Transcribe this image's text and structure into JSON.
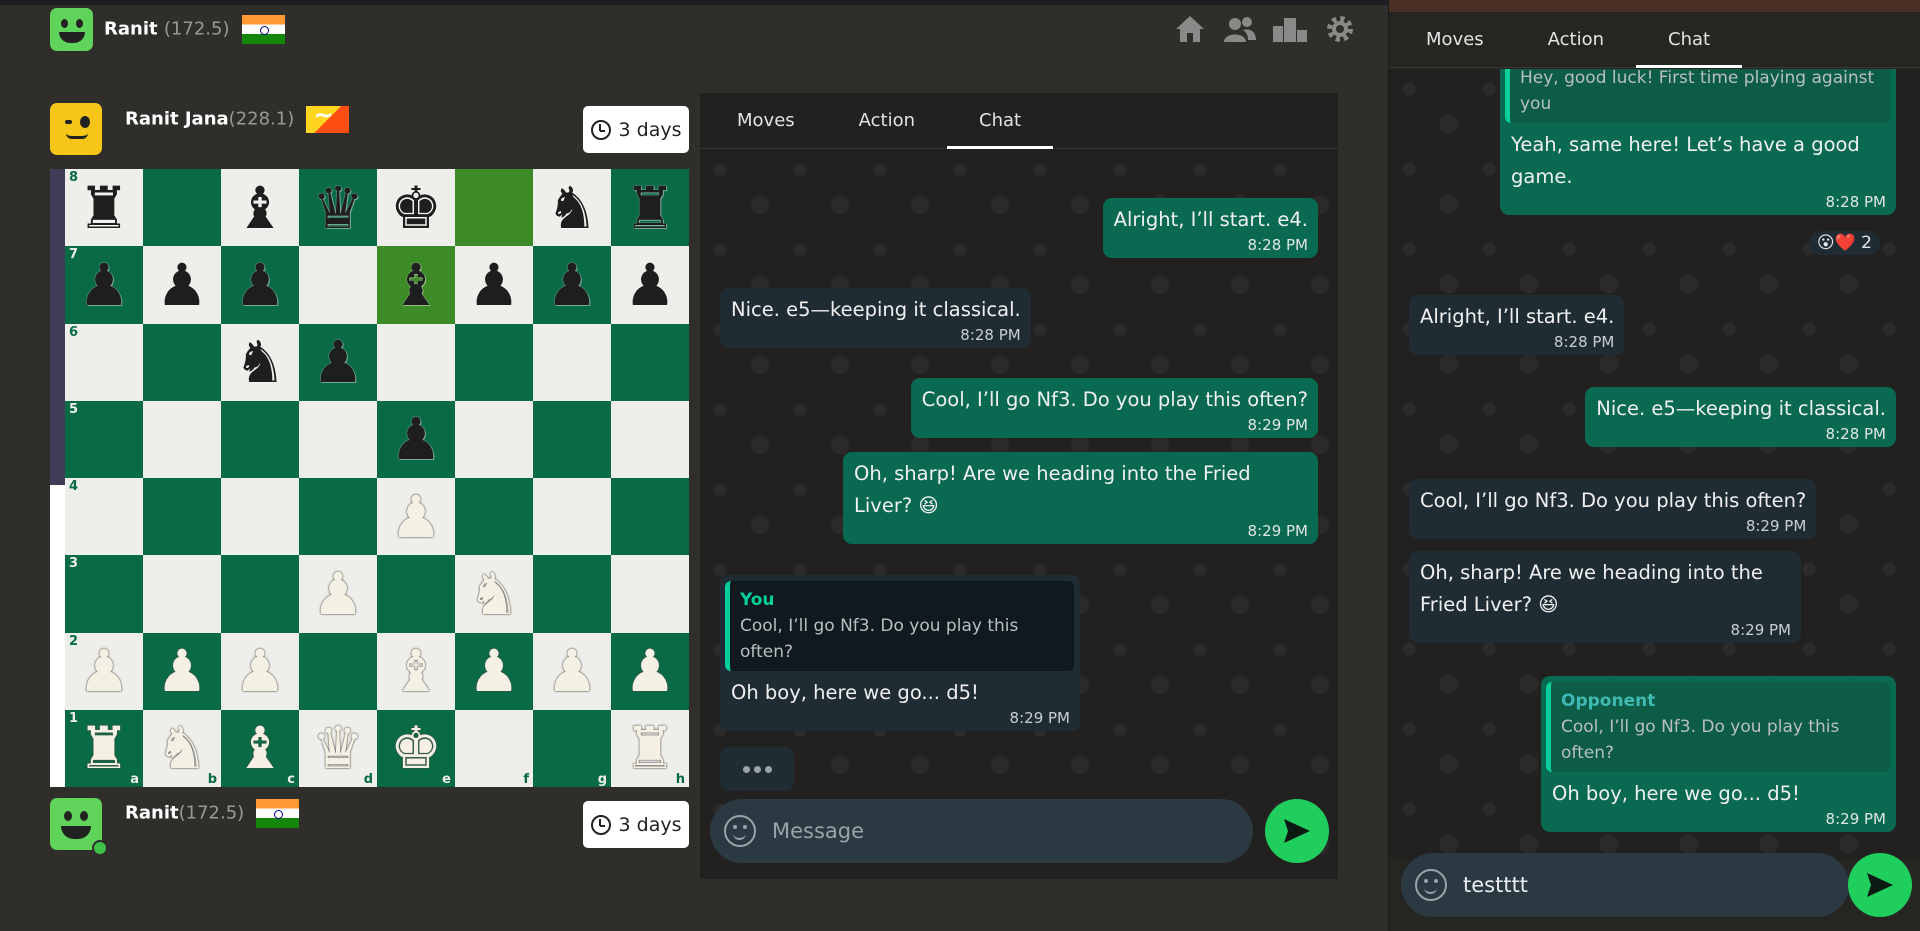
{
  "top_player": {
    "name": "Ranit",
    "rating": "(172.5)"
  },
  "opponent": {
    "name": "Ranit Jana",
    "rating": "(228.1)",
    "clock": "3 days"
  },
  "self": {
    "name": "Ranit",
    "rating": "(172.5)",
    "clock": "3 days"
  },
  "nav_icons": [
    "home-icon",
    "friends-icon",
    "leaderboard-icon",
    "settings-icon"
  ],
  "board": {
    "orientation": "white",
    "highlighted": [
      "e7",
      "f8"
    ],
    "position": [
      [
        "r",
        "",
        "b",
        "q",
        "k",
        "",
        "n",
        "r"
      ],
      [
        "p",
        "p",
        "p",
        "",
        "b",
        "p",
        "p",
        "p"
      ],
      [
        "",
        "",
        "n",
        "p",
        "",
        "",
        "",
        ""
      ],
      [
        "",
        "",
        "",
        "",
        "p",
        "",
        "",
        ""
      ],
      [
        "",
        "",
        "",
        "",
        "P",
        "",
        "",
        ""
      ],
      [
        "",
        "",
        "",
        "P",
        "",
        "N",
        "",
        ""
      ],
      [
        "P",
        "P",
        "P",
        "",
        "B",
        "P",
        "P",
        "P"
      ],
      [
        "R",
        "N",
        "B",
        "Q",
        "K",
        "",
        "",
        "R"
      ]
    ],
    "ranks": [
      "8",
      "7",
      "6",
      "5",
      "4",
      "3",
      "2",
      "1"
    ],
    "files": [
      "a",
      "b",
      "c",
      "d",
      "e",
      "f",
      "g",
      "h"
    ]
  },
  "left_chat": {
    "tabs": [
      "Moves",
      "Action",
      "Chat"
    ],
    "active_tab": "Chat",
    "messages": [
      {
        "dir": "out",
        "text": "Alright, I’ll start. e4.",
        "time": "8:28 PM"
      },
      {
        "dir": "in",
        "text": "Nice. e5—keeping it classical.",
        "time": "8:28 PM"
      },
      {
        "dir": "out",
        "text": "Cool, I’ll go Nf3. Do you play this often?",
        "time": "8:29 PM"
      },
      {
        "dir": "out",
        "text": "Oh, sharp! Are we heading into the Fried Liver? 😆",
        "time": "8:29 PM"
      },
      {
        "dir": "in",
        "quote_name": "You",
        "quote_text": "Cool, I’ll go Nf3. Do you play this often?",
        "text": "Oh boy, here we go... d5!",
        "time": "8:29 PM"
      }
    ],
    "input_placeholder": "Message"
  },
  "right_chat": {
    "tabs": [
      "Moves",
      "Action",
      "Chat"
    ],
    "active_tab": "Chat",
    "messages": [
      {
        "dir": "out",
        "quote_text": "Hey, good luck! First time playing against you",
        "text": "Yeah, same here! Let’s have a good game.",
        "time": "8:28 PM",
        "reactions": "😮❤️ 2"
      },
      {
        "dir": "in",
        "text": "Alright, I’ll start. e4.",
        "time": "8:28 PM"
      },
      {
        "dir": "out",
        "text": "Nice. e5—keeping it classical.",
        "time": "8:28 PM"
      },
      {
        "dir": "in",
        "text": "Cool, I’ll go Nf3. Do you play this often?",
        "time": "8:29 PM"
      },
      {
        "dir": "in",
        "text": "Oh, sharp! Are we heading into the Fried Liver? 😆",
        "time": "8:29 PM"
      },
      {
        "dir": "out",
        "quote_name": "Opponent",
        "quote_text": "Cool, I’ll go Nf3. Do you play this often?",
        "text": "Oh boy, here we go... d5!",
        "time": "8:29 PM"
      }
    ],
    "input_value": "testttt"
  },
  "colors": {
    "board_dark": "#086b45",
    "board_light": "#eeeeea",
    "highlight": "#3d8b26",
    "bubble_out": "#0a6a51",
    "bubble_in": "#202c33",
    "send": "#1fce5c"
  }
}
